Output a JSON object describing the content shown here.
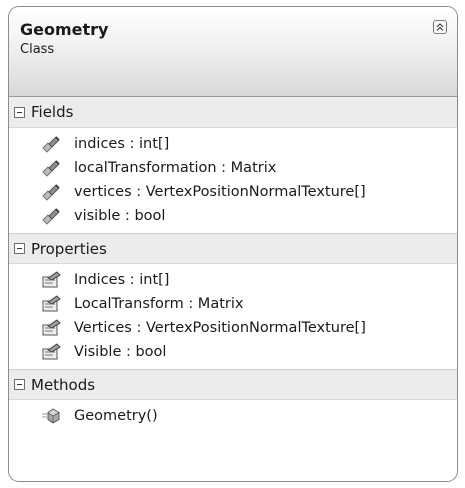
{
  "class": {
    "name": "Geometry",
    "kind": "Class"
  },
  "sections": [
    {
      "title": "Fields",
      "icon": "field-icon",
      "members": [
        "indices : int[]",
        "localTransformation : Matrix",
        "vertices : VertexPositionNormalTexture[]",
        "visible : bool"
      ]
    },
    {
      "title": "Properties",
      "icon": "property-icon",
      "members": [
        "Indices : int[]",
        "LocalTransform : Matrix",
        "Vertices : VertexPositionNormalTexture[]",
        "Visible : bool"
      ]
    },
    {
      "title": "Methods",
      "icon": "method-icon",
      "members": [
        "Geometry()"
      ]
    }
  ]
}
